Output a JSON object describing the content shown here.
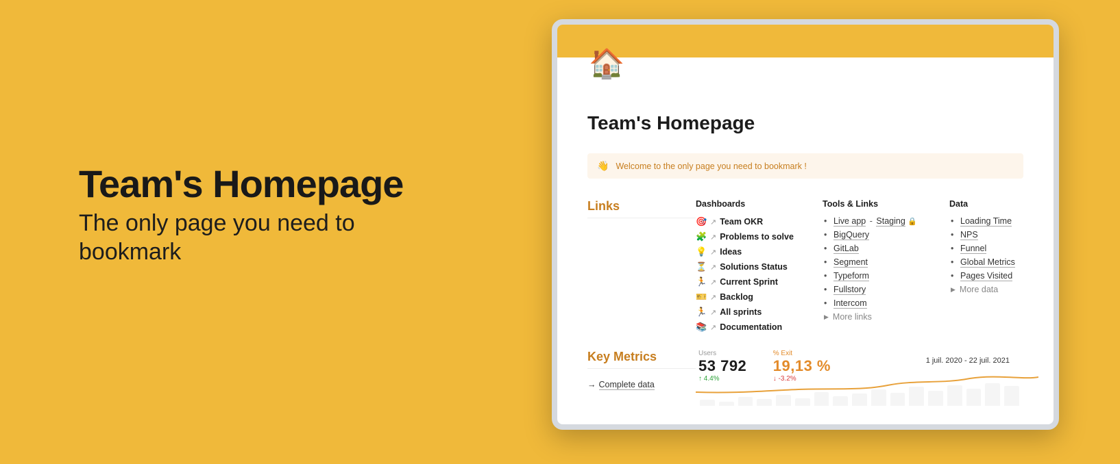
{
  "hero": {
    "title": "Team's Homepage",
    "subtitle": "The only page you need to bookmark"
  },
  "page": {
    "house_emoji": "🏠",
    "title": "Team's Homepage"
  },
  "callout": {
    "emoji": "👋",
    "text": "Welcome to the only page you need to bookmark !"
  },
  "links": {
    "section_title": "Links",
    "dashboards": {
      "header": "Dashboards",
      "items": [
        {
          "emoji": "🎯",
          "label": "Team OKR"
        },
        {
          "emoji": "🧩",
          "label": "Problems to solve"
        },
        {
          "emoji": "💡",
          "label": "Ideas"
        },
        {
          "emoji": "⏳",
          "label": "Solutions Status"
        },
        {
          "emoji": "🏃",
          "label": "Current Sprint"
        },
        {
          "emoji": "🎫",
          "label": "Backlog"
        },
        {
          "emoji": "🏃",
          "label": "All sprints"
        },
        {
          "emoji": "📚",
          "label": "Documentation"
        }
      ]
    },
    "tools": {
      "header": "Tools & Links",
      "live_app": "Live app",
      "staging": "Staging",
      "lock_emoji": "🔒",
      "items": [
        "BigQuery",
        "GitLab",
        "Segment",
        "Typeform",
        "Fullstory",
        "Intercom"
      ],
      "more": "More links"
    },
    "data": {
      "header": "Data",
      "items": [
        "Loading Time",
        "NPS",
        "Funnel",
        "Global Metrics",
        "Pages Visited"
      ],
      "more": "More data"
    }
  },
  "metrics": {
    "section_title": "Key Metrics",
    "complete": "Complete data",
    "users_label": "Users",
    "users_value": "53 792",
    "users_delta": "↑ 4.4%",
    "exit_label": "% Exit",
    "exit_value": "19,13 %",
    "exit_delta": "↓ -3.2%",
    "date_range": "1 juil. 2020 - 22 juil. 2021"
  }
}
